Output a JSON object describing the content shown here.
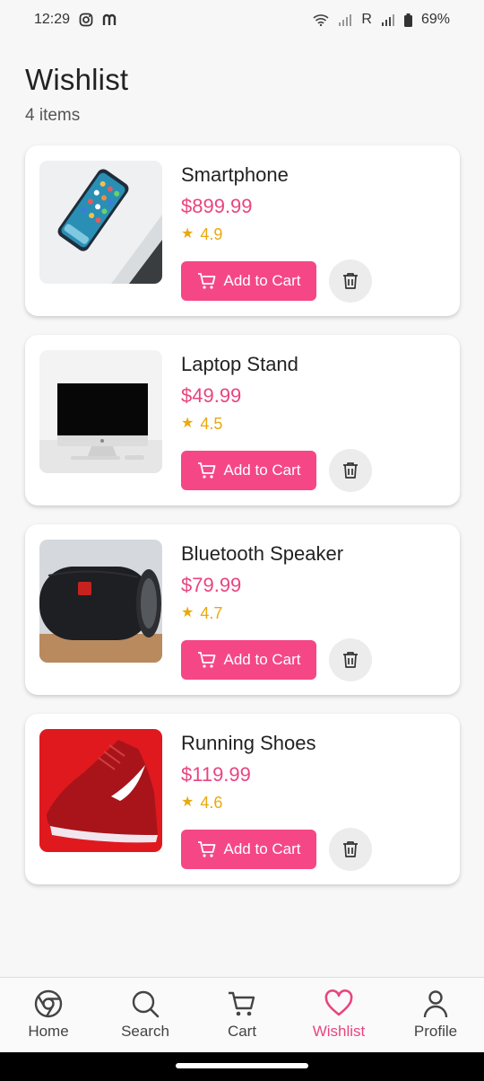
{
  "status": {
    "time": "12:29",
    "carrier_letter": "R",
    "battery": "69%"
  },
  "header": {
    "title": "Wishlist",
    "count": "4 items"
  },
  "items": [
    {
      "name": "Smartphone",
      "price": "$899.99",
      "rating": "4.9"
    },
    {
      "name": "Laptop Stand",
      "price": "$49.99",
      "rating": "4.5"
    },
    {
      "name": "Bluetooth Speaker",
      "price": "$79.99",
      "rating": "4.7"
    },
    {
      "name": "Running Shoes",
      "price": "$119.99",
      "rating": "4.6"
    }
  ],
  "add_to_cart_label": "Add to Cart",
  "nav": [
    {
      "label": "Home",
      "icon": "chrome-icon"
    },
    {
      "label": "Search",
      "icon": "search-icon"
    },
    {
      "label": "Cart",
      "icon": "cart-icon"
    },
    {
      "label": "Wishlist",
      "icon": "heart-icon",
      "active": true
    },
    {
      "label": "Profile",
      "icon": "person-icon"
    }
  ],
  "colors": {
    "accent": "#f54786",
    "price": "#e8457f",
    "star": "#e9a90c"
  }
}
